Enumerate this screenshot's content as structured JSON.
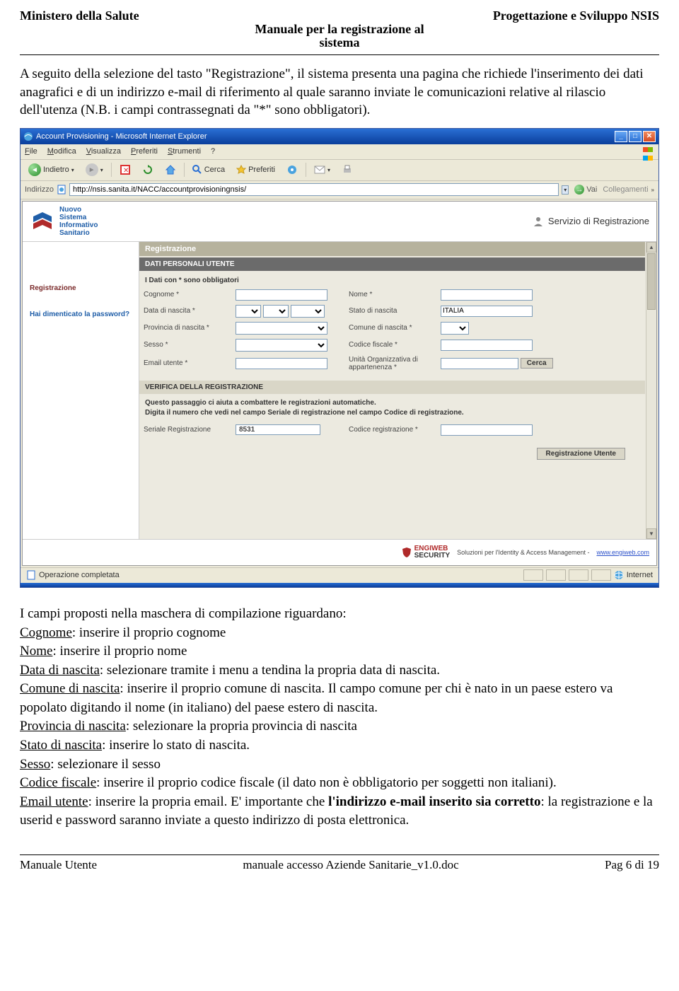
{
  "header": {
    "left": "Ministero della Salute",
    "right": "Progettazione e Sviluppo NSIS",
    "sub1": "Manuale per la registrazione al",
    "sub2": "sistema"
  },
  "intro": "A seguito della selezione del tasto \"Registrazione\", il sistema presenta una pagina che richiede l'inserimento dei dati anagrafici e di un indirizzo e-mail di riferimento al quale saranno inviate le comunicazioni relative al rilascio dell'utenza (N.B. i campi contrassegnati da \"*\" sono obbligatori).",
  "ie": {
    "title": "Account Provisioning - Microsoft Internet Explorer",
    "menu": {
      "file": "File",
      "modifica": "Modifica",
      "visualizza": "Visualizza",
      "preferiti": "Preferiti",
      "strumenti": "Strumenti",
      "help": "?"
    },
    "toolbar": {
      "back": "Indietro",
      "search": "Cerca",
      "fav": "Preferiti"
    },
    "address_label": "Indirizzo",
    "url": "http://nsis.sanita.it/NACC/accountprovisioningnsis/",
    "go": "Vai",
    "links": "Collegamenti",
    "status_left": "Operazione completata",
    "status_right": "Internet"
  },
  "app": {
    "logo": {
      "l1": "Nuovo",
      "l2": "Sistema",
      "l3": "Informativo",
      "l4": "Sanitario"
    },
    "servizio": "Servizio di Registrazione",
    "side": {
      "reg": "Registrazione",
      "forgot": "Hai dimenticato la password?"
    },
    "sec_title": "Registrazione",
    "dark_bar": "DATI PERSONALI UTENTE",
    "mandatory": "I Dati con * sono obbligatori",
    "labels": {
      "cognome": "Cognome *",
      "nome": "Nome *",
      "datan": "Data di nascita *",
      "staton": "Stato di nascita",
      "provn": "Provincia di nascita *",
      "comn": "Comune di nascita *",
      "sesso": "Sesso *",
      "cf": "Codice fiscale *",
      "email": "Email utente *",
      "org": "Unità Organizzativa di appartenenza *",
      "cerca": "Cerca"
    },
    "statoval": "ITALIA",
    "verify_bar": "VERIFICA DELLA REGISTRAZIONE",
    "verify_note1": "Questo passaggio ci aiuta a combattere le registrazioni automatiche.",
    "verify_note2": "Digita il numero che vedi nel campo Seriale di registrazione nel campo Codice di registrazione.",
    "serial_label": "Seriale Registrazione",
    "serial_value": "8531",
    "codice_label": "Codice registrazione *",
    "reg_btn": "Registrazione Utente",
    "footer_text": "Soluzioni per l'Identity & Access Management  -",
    "footer_url": "www.engiweb.com",
    "engiweb_top": "ENGIWEB",
    "engiweb_bot": "SECURITY"
  },
  "list": {
    "intro": "I campi proposti nella maschera di compilazione riguardano:",
    "cognome_l": "Cognome",
    "cognome_t": ": inserire il proprio cognome",
    "nome_l": "Nome",
    "nome_t": ": inserire il proprio nome",
    "datan_l": "Data di nascita",
    "datan_t": ": selezionare tramite i menu a tendina la propria data di nascita.",
    "comn_l": "Comune di nascita",
    "comn_t": ": inserire il proprio comune di nascita. Il campo comune per chi è nato in un paese estero va popolato digitando il nome (in italiano) del paese estero di nascita.",
    "provn_l": "Provincia di nascita",
    "provn_t": ": selezionare la propria provincia di nascita",
    "staton_l": "Stato di nascita",
    "staton_t": ": inserire lo stato di nascita.",
    "sesso_l": "Sesso",
    "sesso_t": ": selezionare il sesso",
    "cf_l": "Codice fiscale",
    "cf_t": ": inserire il proprio codice fiscale (il dato non è obbligatorio per soggetti non italiani).",
    "email_l": "Email utente",
    "email_t1": ": inserire la propria email. E' importante che ",
    "email_b": "l'indirizzo e-mail inserito sia corretto",
    "email_t2": ": la registrazione e la userid e password saranno inviate a questo indirizzo di posta elettronica."
  },
  "footer": {
    "left": "Manuale Utente",
    "center": "manuale accesso Aziende Sanitarie_v1.0.doc",
    "right": "Pag 6 di 19"
  }
}
